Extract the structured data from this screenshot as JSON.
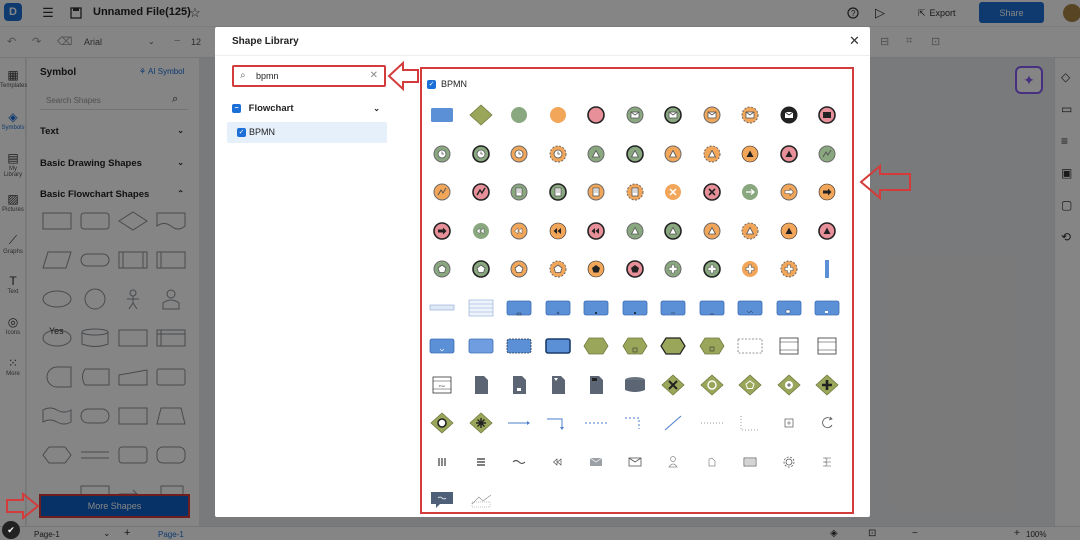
{
  "app": {
    "file_name": "Unnamed File(125)",
    "font_name": "Arial",
    "font_size": "12",
    "export_label": "Export",
    "share_label": "Share"
  },
  "left_rail": [
    {
      "label": "Templates",
      "icon": "templates-icon"
    },
    {
      "label": "Symbols",
      "icon": "symbols-icon",
      "active": true
    },
    {
      "label": "My Library",
      "icon": "library-icon"
    },
    {
      "label": "Pictures",
      "icon": "pictures-icon"
    },
    {
      "label": "Graphs",
      "icon": "graphs-icon"
    },
    {
      "label": "Text",
      "icon": "text-icon"
    },
    {
      "label": "Icons",
      "icon": "icons-icon"
    },
    {
      "label": "More",
      "icon": "more-icon"
    }
  ],
  "symbol_panel": {
    "title": "Symbol",
    "ai_symbol": "AI Symbol",
    "search_placeholder": "Search Shapes",
    "sections": [
      "Text",
      "Basic Drawing Shapes",
      "Basic Flowchart Shapes"
    ],
    "yes_label": "Yes",
    "more_shapes": "More Shapes"
  },
  "status_bar": {
    "page_tab": "Page-1",
    "active_page": "Page-1",
    "zoom": "100%"
  },
  "modal": {
    "title": "Shape Library",
    "search_value": "bpmn",
    "category": "Flowchart",
    "category_item": "BPMN",
    "shapes_header": "BPMN"
  },
  "colors": {
    "accent": "#1b6fd6",
    "highlight": "#d43b3b",
    "bpmn_blue": "#5b8fd6",
    "bpmn_green": "#8aa880",
    "bpmn_orange": "#f2a65a",
    "bpmn_olive": "#9aa75a",
    "bpmn_pink": "#e8909a"
  }
}
